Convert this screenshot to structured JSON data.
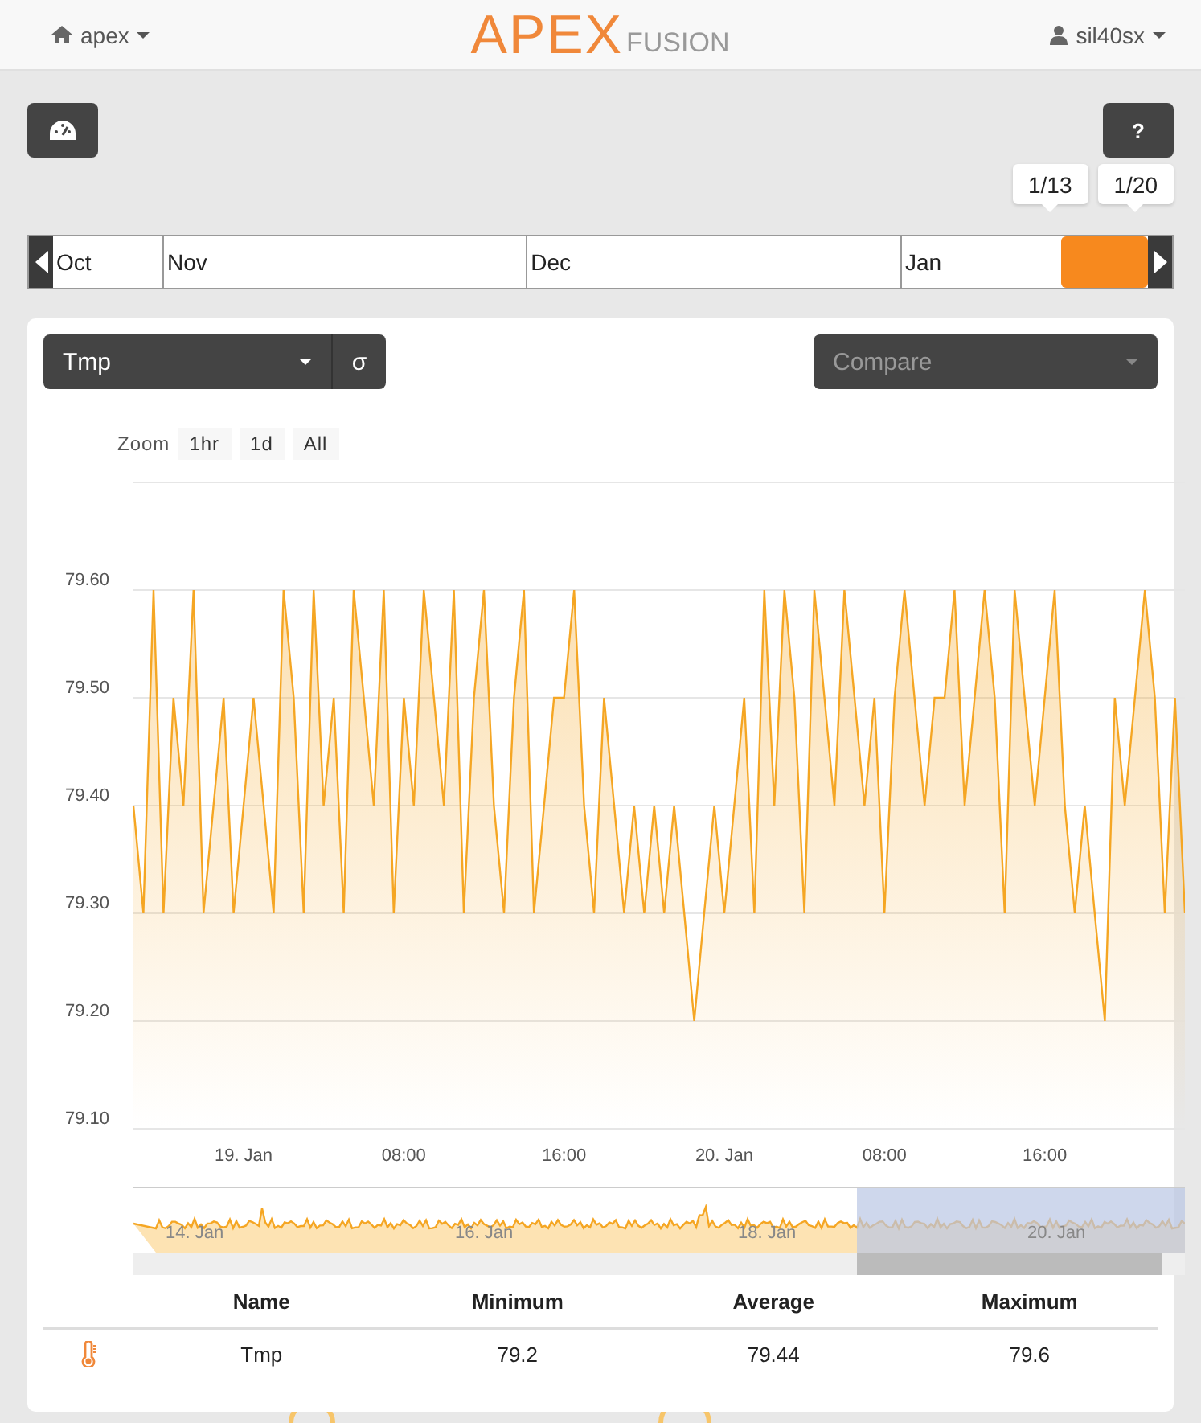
{
  "navbar": {
    "home_menu": {
      "label": "apex"
    },
    "logo": {
      "primary": "APEX",
      "secondary": "FUSION"
    },
    "user_menu": {
      "label": "sil40sx"
    }
  },
  "toolbar": {
    "help_button": {
      "label": "?"
    }
  },
  "timeline": {
    "months": [
      {
        "label": "Oct"
      },
      {
        "label": "Nov"
      },
      {
        "label": "Dec"
      },
      {
        "label": "Jan"
      }
    ],
    "range_start": "1/13",
    "range_end": "1/20"
  },
  "panel": {
    "probe_select": {
      "value": "Tmp"
    },
    "sigma_button": {
      "label": "σ"
    },
    "compare_select": {
      "placeholder": "Compare"
    },
    "zoom": {
      "label": "Zoom",
      "options": [
        {
          "label": "1hr",
          "selected": false
        },
        {
          "label": "1d",
          "selected": false
        },
        {
          "label": "All",
          "selected": false
        }
      ]
    },
    "chart_data": {
      "type": "area",
      "grid": true,
      "categories": [
        null,
        null,
        null,
        null,
        null,
        null,
        null,
        null,
        null,
        null,
        null,
        "19. Jan",
        null,
        null,
        null,
        null,
        null,
        null,
        null,
        null,
        null,
        null,
        null,
        null,
        null,
        null,
        null,
        "08:00",
        null,
        null,
        null,
        null,
        null,
        null,
        null,
        null,
        null,
        null,
        null,
        null,
        null,
        null,
        null,
        "16:00",
        null,
        null,
        null,
        null,
        null,
        null,
        null,
        null,
        null,
        null,
        null,
        null,
        null,
        null,
        null,
        "20. Jan",
        null,
        null,
        null,
        null,
        null,
        null,
        null,
        null,
        null,
        null,
        null,
        null,
        null,
        null,
        null,
        "08:00",
        null,
        null,
        null,
        null,
        null,
        null,
        null,
        null,
        null,
        null,
        null,
        null,
        null,
        null,
        null,
        "16:00",
        null,
        null,
        null,
        null,
        null,
        null,
        null,
        null,
        null,
        null,
        null,
        null,
        null,
        null
      ],
      "ylim": [
        79.1,
        79.7
      ],
      "yticks": [
        {
          "value": 79.1,
          "label": "79.10"
        },
        {
          "value": 79.2,
          "label": "79.20"
        },
        {
          "value": 79.3,
          "label": "79.30"
        },
        {
          "value": 79.4,
          "label": "79.40"
        },
        {
          "value": 79.5,
          "label": "79.50"
        },
        {
          "value": 79.6,
          "label": "79.60"
        }
      ],
      "series": [
        {
          "color": "#f5a623",
          "values": [
            79.4,
            79.3,
            79.6,
            79.3,
            79.5,
            79.4,
            79.6,
            79.3,
            79.4,
            79.5,
            79.3,
            79.4,
            79.5,
            79.4,
            79.3,
            79.6,
            79.5,
            79.3,
            79.6,
            79.4,
            79.5,
            79.3,
            79.6,
            79.5,
            79.4,
            79.6,
            79.3,
            79.5,
            79.4,
            79.6,
            79.5,
            79.4,
            79.6,
            79.3,
            79.5,
            79.6,
            79.4,
            79.3,
            79.5,
            79.6,
            79.3,
            79.4,
            79.5,
            79.5,
            79.6,
            79.4,
            79.3,
            79.5,
            79.4,
            79.3,
            79.4,
            79.3,
            79.4,
            79.3,
            79.4,
            79.3,
            79.2,
            79.3,
            79.4,
            79.3,
            79.4,
            79.5,
            79.3,
            79.6,
            79.4,
            79.6,
            79.5,
            79.3,
            79.6,
            79.5,
            79.4,
            79.6,
            79.5,
            79.4,
            79.5,
            79.3,
            79.5,
            79.6,
            79.5,
            79.4,
            79.5,
            79.5,
            79.6,
            79.4,
            79.5,
            79.6,
            79.5,
            79.3,
            79.6,
            79.5,
            79.4,
            79.5,
            79.6,
            79.4,
            79.3,
            79.4,
            79.3,
            79.2,
            79.5,
            79.4,
            79.5,
            79.6,
            79.5,
            79.3,
            79.5,
            79.3
          ]
        }
      ]
    },
    "navigator": {
      "labels": [
        "14. Jan",
        "16. Jan",
        "18. Jan",
        "20. Jan"
      ]
    },
    "stats": {
      "columns": [
        "Name",
        "Minimum",
        "Average",
        "Maximum"
      ],
      "rows": [
        {
          "name": "Tmp",
          "minimum": "79.2",
          "average": "79.44",
          "maximum": "79.6"
        }
      ]
    }
  }
}
